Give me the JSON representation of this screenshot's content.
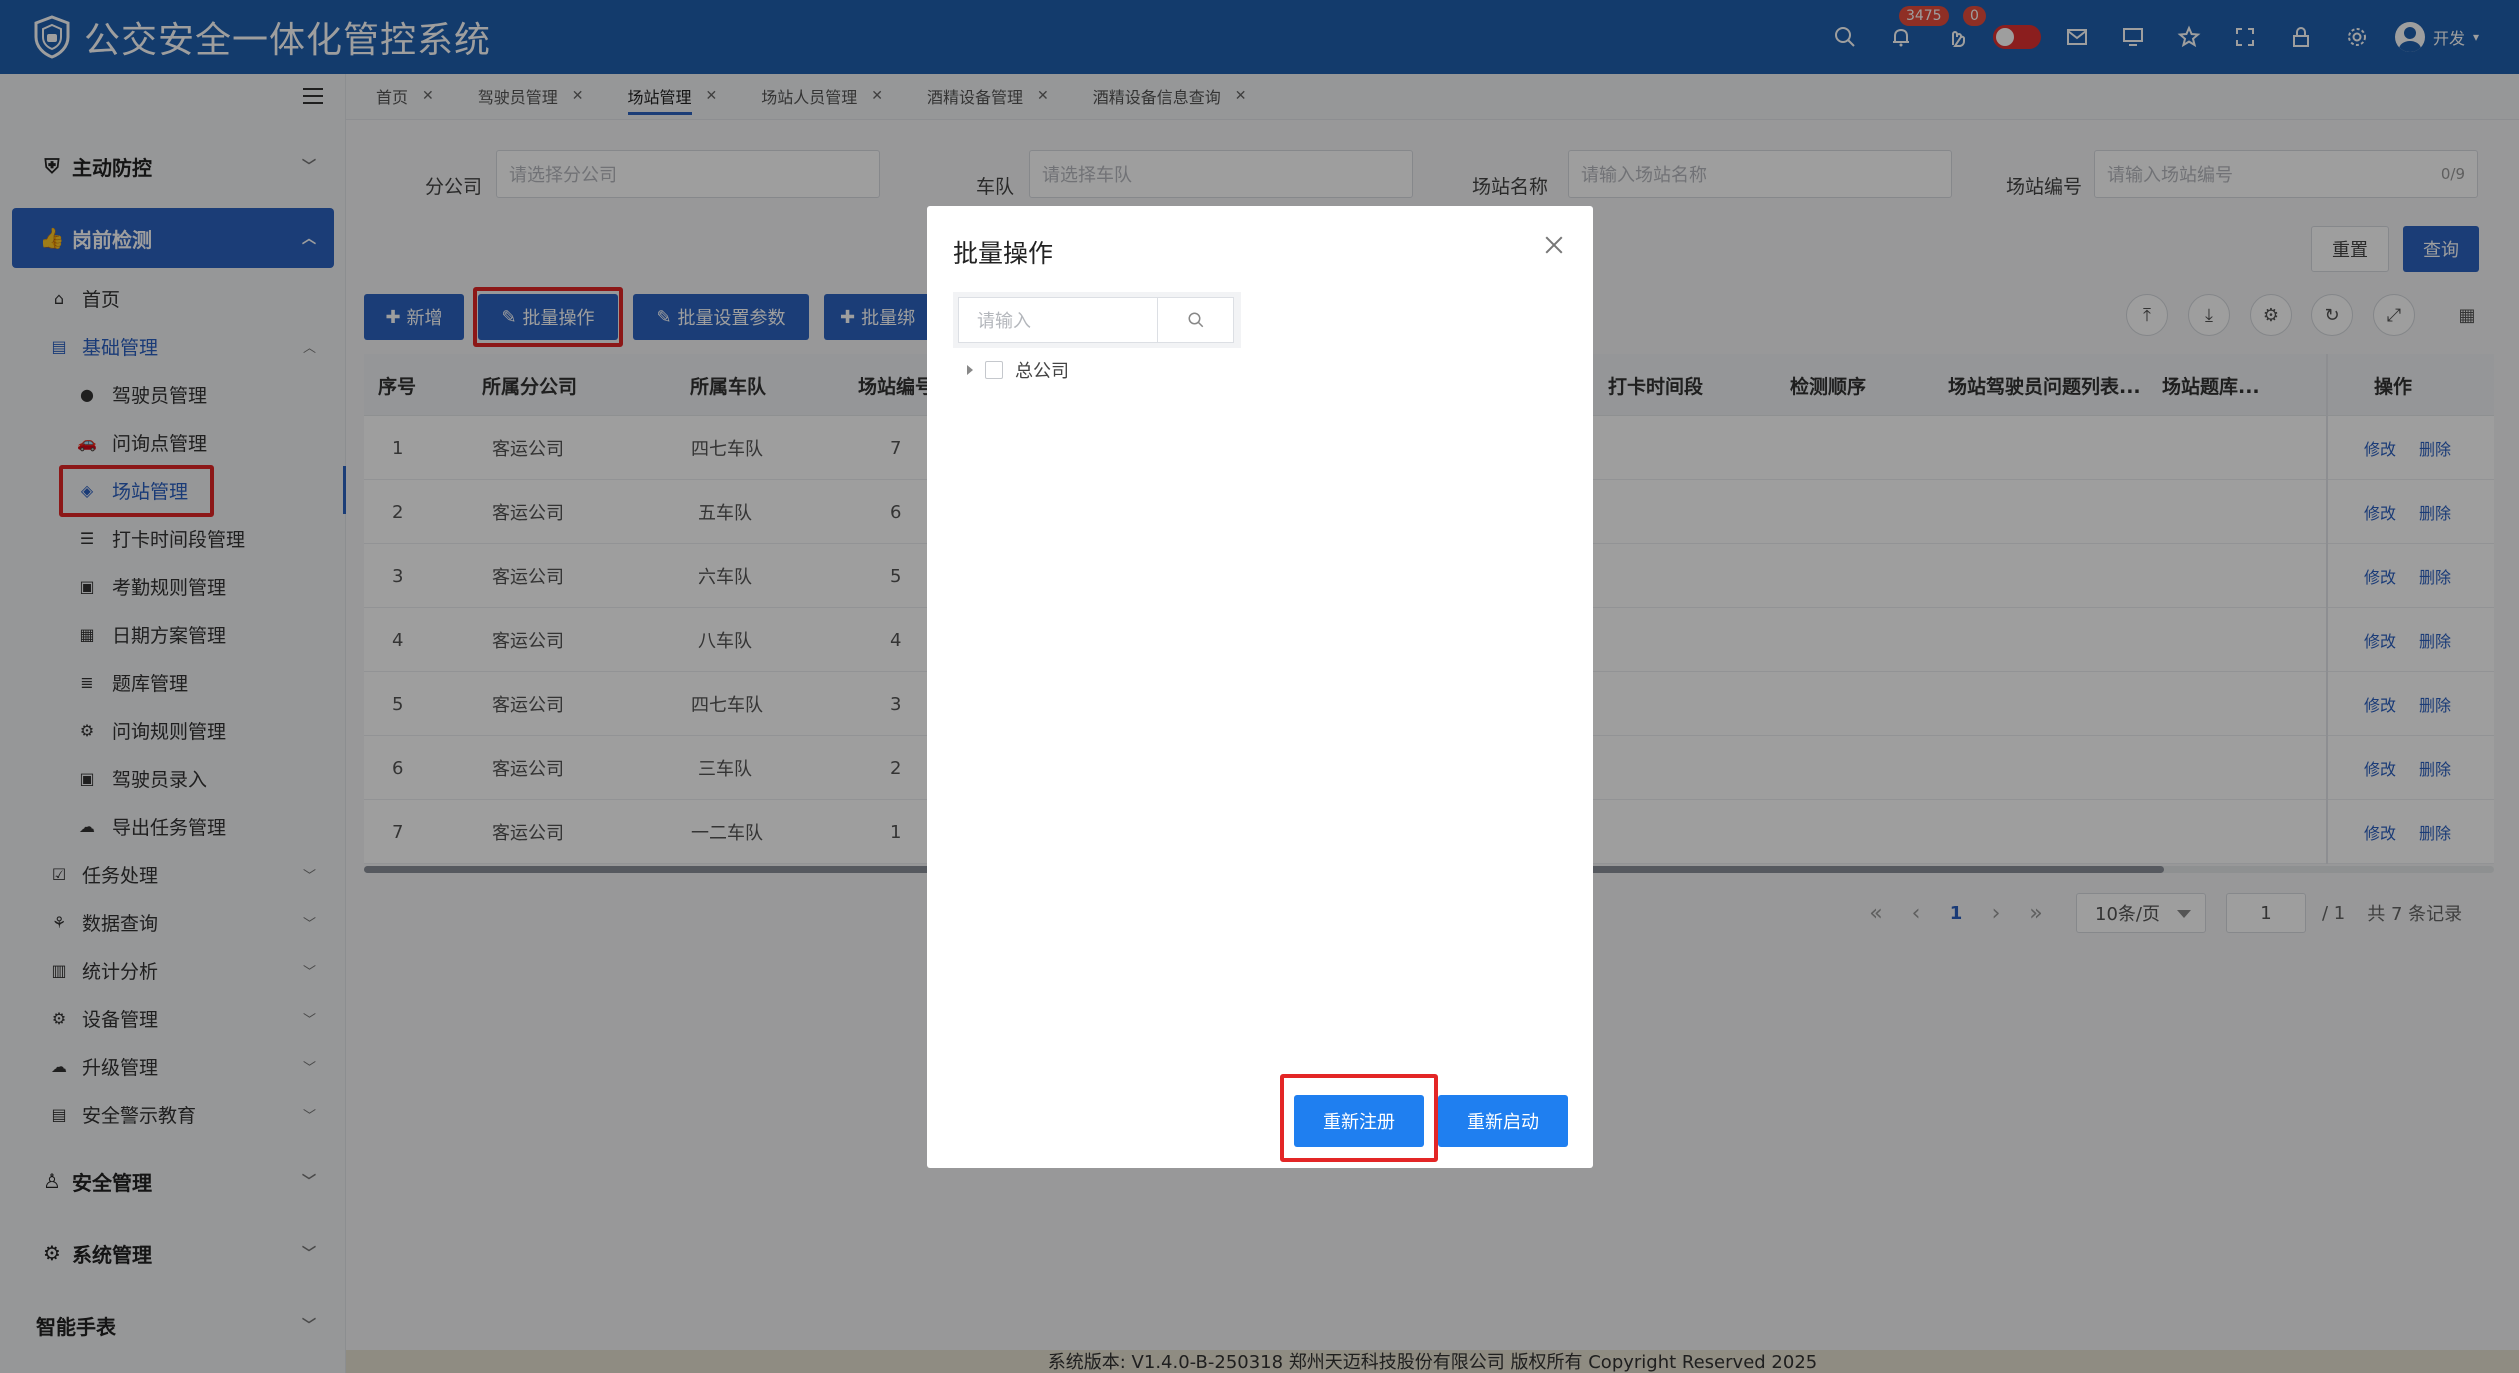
{
  "app": {
    "title": "公交安全一体化管控系统",
    "brand_color": "#1f5fae",
    "accent_color": "#2d63c0",
    "notice_badge": "3475",
    "alarm_badge": "0",
    "user_name": "开发"
  },
  "header_icons": [
    "search-icon",
    "bell-icon",
    "hand-icon",
    "toggle-switch",
    "mail-icon",
    "monitor-icon",
    "star-icon",
    "fullscreen-icon",
    "lock-icon",
    "gear-icon"
  ],
  "sidebar": {
    "groups": [
      {
        "label": "主动防控",
        "icon": "shield-icon"
      },
      {
        "label": "岗前检测",
        "icon": "thumb-icon",
        "active": true
      },
      {
        "label": "安全管理",
        "icon": "person-icon"
      },
      {
        "label": "系统管理",
        "icon": "gear-icon"
      },
      {
        "label": "智能手表",
        "icon": ""
      }
    ],
    "sub_home": "首页",
    "sub_basic": "基础管理",
    "leaves": [
      "驾驶员管理",
      "问询点管理",
      "场站管理",
      "打卡时间段管理",
      "考勤规则管理",
      "日期方案管理",
      "题库管理",
      "问询规则管理",
      "驾驶员录入",
      "导出任务管理"
    ],
    "subs": [
      "任务处理",
      "数据查询",
      "统计分析",
      "设备管理",
      "升级管理",
      "安全警示教育"
    ]
  },
  "tabs": [
    "首页",
    "驾驶员管理",
    "场站管理",
    "场站人员管理",
    "酒精设备管理",
    "酒精设备信息查询"
  ],
  "filters": {
    "branch_label": "分公司",
    "branch_placeholder": "请选择分公司",
    "fleet_label": "车队",
    "fleet_placeholder": "请选择车队",
    "station_name_label": "场站名称",
    "station_name_placeholder": "请输入场站名称",
    "station_no_label": "场站编号",
    "station_no_placeholder": "请输入场站编号",
    "station_no_count": "0/9",
    "reset": "重置",
    "query": "查询"
  },
  "toolbar": {
    "add": "新增",
    "batch_op": "批量操作",
    "batch_params": "批量设置参数",
    "batch_bind": "批量绑"
  },
  "table": {
    "headers": [
      "序号",
      "所属分公司",
      "所属车队",
      "场站编号",
      "打卡时间段",
      "检测顺序",
      "场站驾驶员问题列表...",
      "场站题库...",
      "操作"
    ],
    "rows": [
      {
        "no": "1",
        "branch": "客运公司",
        "fleet": "四七车队",
        "code": "7"
      },
      {
        "no": "2",
        "branch": "客运公司",
        "fleet": "五车队",
        "code": "6"
      },
      {
        "no": "3",
        "branch": "客运公司",
        "fleet": "六车队",
        "code": "5"
      },
      {
        "no": "4",
        "branch": "客运公司",
        "fleet": "八车队",
        "code": "4"
      },
      {
        "no": "5",
        "branch": "客运公司",
        "fleet": "四七车队",
        "code": "3"
      },
      {
        "no": "6",
        "branch": "客运公司",
        "fleet": "三车队",
        "code": "2"
      },
      {
        "no": "7",
        "branch": "客运公司",
        "fleet": "一二车队",
        "code": "1"
      }
    ],
    "edit": "修改",
    "delete": "删除"
  },
  "pagination": {
    "current": "1",
    "page_size": "10条/页",
    "jump": "1",
    "total_pages": "/ 1",
    "total": "共 7 条记录"
  },
  "footer": "系统版本: V1.4.0-B-250318 郑州天迈科技股份有限公司 版权所有 Copyright Reserved 2025",
  "modal": {
    "title": "批量操作",
    "search_placeholder": "请输入",
    "tree_root": "总公司",
    "re_register": "重新注册",
    "restart": "重新启动",
    "button_color": "#1f7ff0"
  },
  "highlight_color": "#e32626"
}
